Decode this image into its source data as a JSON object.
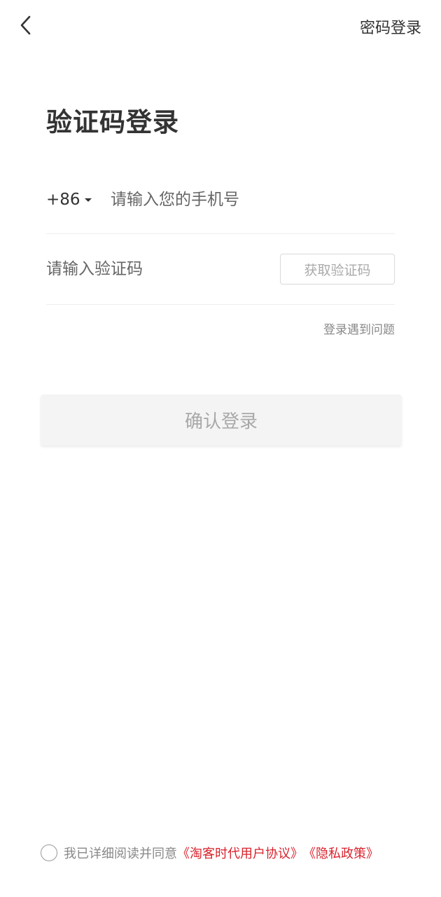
{
  "header": {
    "switch_link": "密码登录"
  },
  "title": "验证码登录",
  "phone": {
    "country_code": "+86",
    "placeholder": "请输入您的手机号",
    "value": ""
  },
  "code": {
    "placeholder": "请输入验证码",
    "value": "",
    "get_code_label": "获取验证码"
  },
  "help_link": "登录遇到问题",
  "confirm_label": "确认登录",
  "agreement": {
    "checked": false,
    "text": "我已详细阅读并同意",
    "user_agreement": "《淘客时代用户协议》",
    "privacy_policy": "《隐私政策》"
  },
  "colors": {
    "accent_red": "#d9232d",
    "button_disabled_bg": "#f4f4f4",
    "button_disabled_text": "#a8a8a8"
  },
  "icons": {
    "back": "chevron-left-icon",
    "country_dropdown": "caret-down-icon"
  }
}
